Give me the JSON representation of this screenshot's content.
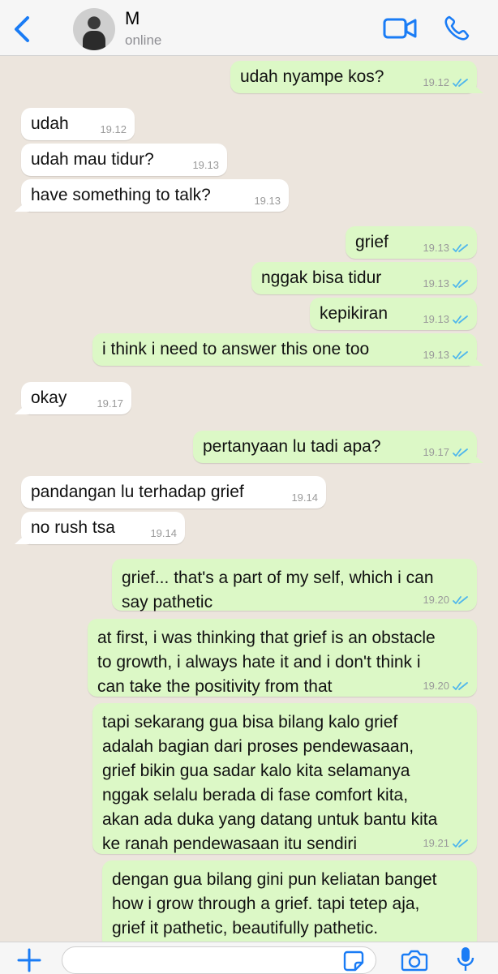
{
  "header": {
    "contact_name": "M",
    "status": "online",
    "icons": [
      "back-chevron-icon",
      "avatar",
      "video-call-icon",
      "voice-call-icon"
    ]
  },
  "messages": [
    {
      "dir": "out",
      "text": "udah nyampe kos?",
      "time": "19.12",
      "read": true,
      "tail": true
    },
    {
      "dir": "in",
      "text": "udah",
      "time": "19.12",
      "tail": false
    },
    {
      "dir": "in",
      "text": "udah mau tidur?",
      "time": "19.13",
      "tail": false
    },
    {
      "dir": "in",
      "text": "have something to talk?",
      "time": "19.13",
      "tail": true
    },
    {
      "dir": "out",
      "text": "grief",
      "time": "19.13",
      "read": true,
      "tail": false
    },
    {
      "dir": "out",
      "text": "nggak bisa tidur",
      "time": "19.13",
      "read": true,
      "tail": false
    },
    {
      "dir": "out",
      "text": "kepikiran",
      "time": "19.13",
      "read": true,
      "tail": false
    },
    {
      "dir": "out",
      "text": "i think i need to answer this one too",
      "time": "19.13",
      "read": true,
      "tail": true
    },
    {
      "dir": "in",
      "text": "okay",
      "time": "19.17",
      "tail": true
    },
    {
      "dir": "out",
      "text": "pertanyaan lu tadi apa?",
      "time": "19.17",
      "read": true,
      "tail": true
    },
    {
      "dir": "in",
      "text": "pandangan lu terhadap grief",
      "time": "19.14",
      "tail": false
    },
    {
      "dir": "in",
      "text": "no rush tsa",
      "time": "19.14",
      "tail": true
    },
    {
      "dir": "out",
      "lines": [
        "grief... that's a part of my self, which i can",
        "say pathetic"
      ],
      "time": "19.20",
      "read": true,
      "tail": false
    },
    {
      "dir": "out",
      "lines": [
        "at first, i was thinking that grief is an obstacle",
        "to growth, i always hate it and i don't think i",
        "can take the positivity from that"
      ],
      "time": "19.20",
      "read": true,
      "tail": false
    },
    {
      "dir": "out",
      "lines": [
        "tapi sekarang gua bisa bilang kalo grief",
        "adalah bagian dari proses pendewasaan,",
        "grief bikin gua sadar kalo kita selamanya",
        "nggak selalu berada di fase comfort kita,",
        "akan ada duka yang datang untuk bantu kita",
        "ke ranah pendewasaan itu sendiri"
      ],
      "time": "19.21",
      "read": true,
      "tail": false
    },
    {
      "dir": "out",
      "lines": [
        "dengan gua bilang gini pun keliatan banget",
        "how i grow through a grief. tapi tetep aja,",
        "grief it pathetic, beautifully pathetic."
      ],
      "time": "",
      "read": false,
      "tail": false
    }
  ],
  "input_bar": {
    "placeholder": "",
    "icons": [
      "plus-icon",
      "sticker-icon",
      "camera-icon",
      "microphone-icon"
    ]
  },
  "colors": {
    "accent": "#1A7CF5",
    "incoming_bubble": "#FFFFFF",
    "outgoing_bubble": "#DCF8C6",
    "read_ticks": "#4FB6EC",
    "chat_background": "#ECE5DD"
  }
}
